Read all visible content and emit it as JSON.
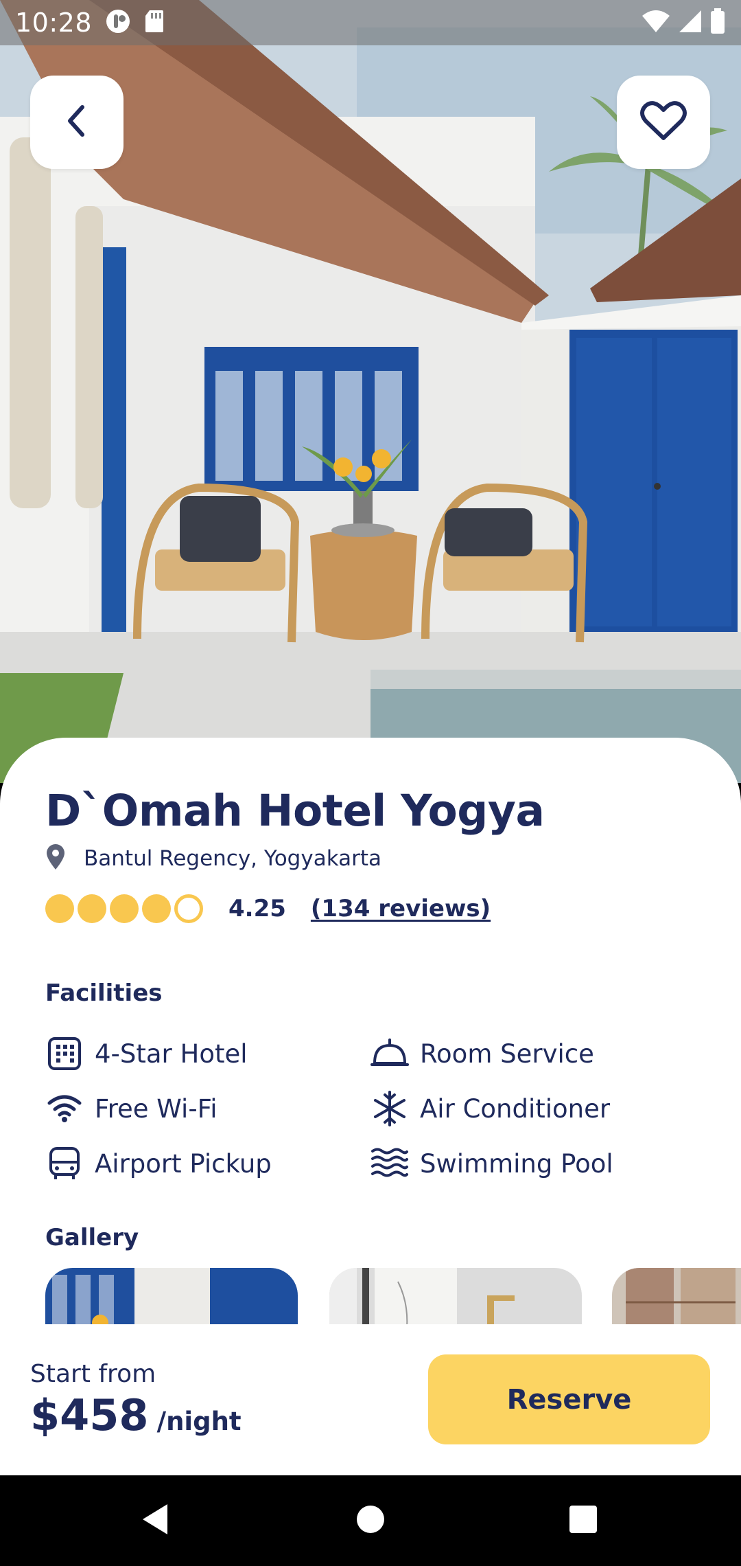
{
  "status_bar": {
    "time": "10:28",
    "icons": [
      "app-notification-icon",
      "sd-card-icon",
      "wifi-icon",
      "cellular-signal-icon",
      "battery-icon"
    ]
  },
  "hero": {
    "back_icon": "chevron-left-icon",
    "favorite_icon": "heart-outline-icon"
  },
  "hotel": {
    "name": "D`Omah Hotel Yogya",
    "location_icon": "map-pin-icon",
    "location": "Bantul Regency, Yogyakarta",
    "rating": {
      "value": "4.25",
      "filled_stars": 4,
      "total_stars": 5,
      "reviews": "(134 reviews)",
      "star_color": "#f9c74f"
    }
  },
  "facilities": {
    "title": "Facilities",
    "items": [
      {
        "label": "4-Star Hotel",
        "icon": "building-icon"
      },
      {
        "label": "Room Service",
        "icon": "cloche-icon"
      },
      {
        "label": "Free Wi-Fi",
        "icon": "wifi-icon"
      },
      {
        "label": "Air Conditioner",
        "icon": "snowflake-icon"
      },
      {
        "label": "Airport Pickup",
        "icon": "bus-icon"
      },
      {
        "label": "Swimming Pool",
        "icon": "waves-icon"
      }
    ]
  },
  "gallery": {
    "title": "Gallery"
  },
  "booking": {
    "start_from_label": "Start from",
    "price": "$458",
    "per_night": "/night",
    "reserve_label": "Reserve",
    "accent_color": "#fcd462"
  },
  "nav_bar": {
    "back_icon": "nav-back-icon",
    "home_icon": "nav-home-icon",
    "recents_icon": "nav-recents-icon"
  },
  "colors": {
    "primary_text": "#1f2a5c",
    "background": "#ffffff"
  }
}
